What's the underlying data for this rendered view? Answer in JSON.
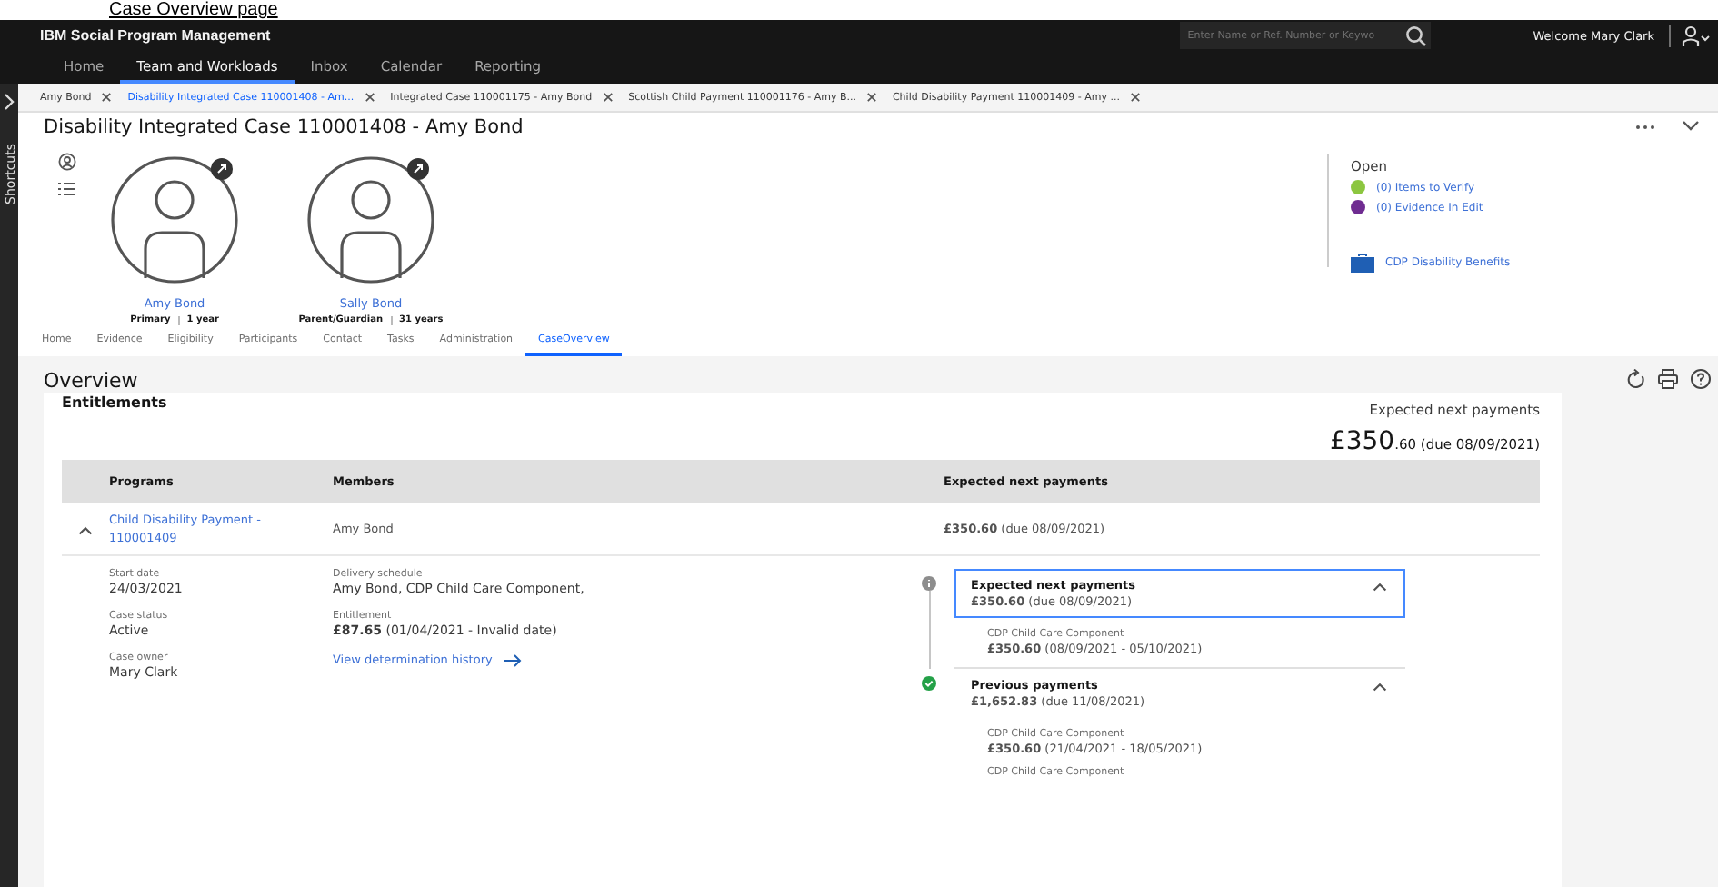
{
  "heading": "Case Overview page",
  "app": {
    "title": "IBM Social Program Management",
    "search": {
      "placeholder": "Enter Name or Ref. Number or Keywo"
    },
    "welcome": "Welcome Mary Clark"
  },
  "nav": [
    {
      "label": "Home",
      "selected": false
    },
    {
      "label": "Team and Workloads",
      "selected": true
    },
    {
      "label": "Inbox",
      "selected": false
    },
    {
      "label": "Calendar",
      "selected": false
    },
    {
      "label": "Reporting",
      "selected": false
    }
  ],
  "sidebar": {
    "label": "Shortcuts"
  },
  "open_tabs": [
    {
      "label": "Amy Bond",
      "selected": false
    },
    {
      "label": "Disability Integrated Case 110001408 - Am...",
      "selected": true
    },
    {
      "label": "Integrated Case 110001175 - Amy Bond",
      "selected": false
    },
    {
      "label": "Scottish Child Payment 110001176 - Amy B...",
      "selected": false
    },
    {
      "label": "Child Disability Payment 110001409 - Amy ...",
      "selected": false
    }
  ],
  "case": {
    "title": "Disability Integrated Case 110001408 - Amy Bond",
    "participants": [
      {
        "name": "Amy Bond",
        "role": "Primary",
        "age": "1 year"
      },
      {
        "name": "Sally Bond",
        "role": "Parent/Guardian",
        "age": "31 years"
      }
    ],
    "open": {
      "title": "Open",
      "items": [
        {
          "label": "(0) Items to Verify",
          "color": "#8cc63f"
        },
        {
          "label": "(0) Evidence In Edit",
          "color": "#6f2c91"
        }
      ],
      "benefit": "CDP Disability Benefits"
    },
    "tabs": [
      {
        "label": "Home",
        "selected": false
      },
      {
        "label": "Evidence",
        "selected": false
      },
      {
        "label": "Eligibility",
        "selected": false
      },
      {
        "label": "Participants",
        "selected": false
      },
      {
        "label": "Contact",
        "selected": false
      },
      {
        "label": "Tasks",
        "selected": false
      },
      {
        "label": "Administration",
        "selected": false
      },
      {
        "label": "CaseOverview",
        "selected": true
      }
    ]
  },
  "overview": {
    "title": "Overview",
    "section": "Entitlements",
    "summary": {
      "label": "Expected next payments",
      "amount_major": "£350",
      "amount_minor": ".60",
      "due": "(due 08/09/2021)"
    },
    "table": {
      "columns": [
        "Programs",
        "Members",
        "Expected next payments"
      ],
      "rows": [
        {
          "expanded": true,
          "program": "Child Disability Payment - 110001409",
          "member": "Amy Bond",
          "payment": "**£350.60** (due 08/09/2021)",
          "details": [
            {
              "label": "Start date",
              "value": "24/03/2021"
            },
            {
              "label": "Case status",
              "value": "Active"
            },
            {
              "label": "Case owner",
              "value": "Mary Clark"
            }
          ],
          "schedule": [
            {
              "label": "Delivery schedule",
              "value": "Amy Bond, CDP Child Care Component,"
            },
            {
              "label": "Entitlement",
              "value": "**£87.65** (01/04/2021 - Invalid date)"
            }
          ],
          "link": "View determination history",
          "timeline": [
            {
              "paid": false,
              "selected": true,
              "expanded": true,
              "title": "Expected next payments",
              "amount": "**£350.60** (due 08/09/2021)",
              "items": [
                {
                  "label": "CDP Child Care Component",
                  "value": "**£350.60** (08/09/2021 - 05/10/2021)"
                }
              ]
            },
            {
              "paid": true,
              "selected": false,
              "expanded": true,
              "title": "Previous payments",
              "amount": "**£1,652.83** (due 11/08/2021)",
              "items": [
                {
                  "label": "CDP Child Care Component",
                  "value": "**£350.60** (21/04/2021 - 18/05/2021)"
                },
                {
                  "label": "CDP Child Care Component"
                }
              ]
            }
          ]
        }
      ]
    }
  }
}
